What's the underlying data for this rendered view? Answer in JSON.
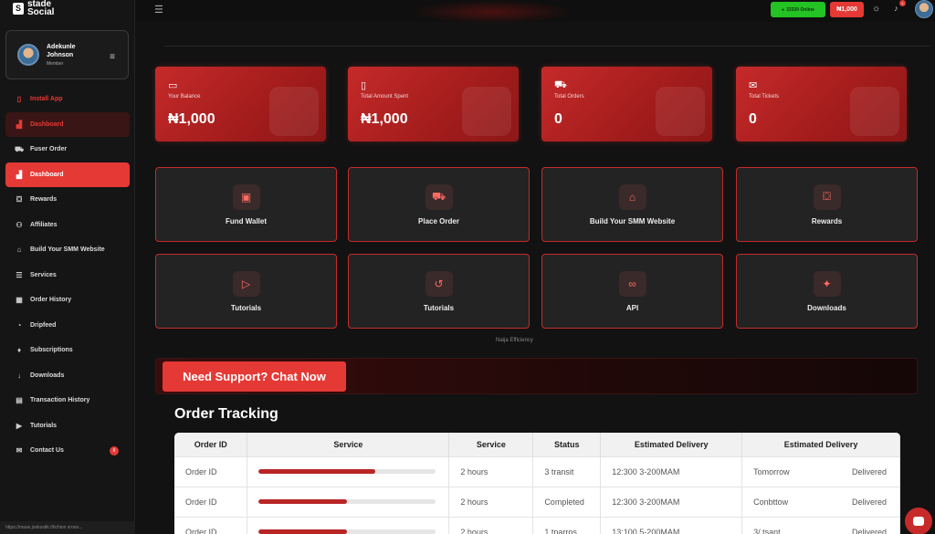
{
  "brand": {
    "line1": "stade",
    "line2": "Social"
  },
  "user": {
    "name": "Adekunle Johnson",
    "role": "Member"
  },
  "topbar": {
    "online_text": "33330 Online",
    "balance": "₦1,000",
    "notif_count": "1"
  },
  "nav": [
    {
      "label": "Install App",
      "icon": "download-app-icon",
      "glyph": "▯",
      "state": "red-text"
    },
    {
      "label": "Dashboard",
      "icon": "chart-icon",
      "glyph": "▟",
      "state": "dim-active"
    },
    {
      "label": "Fuser Order",
      "icon": "cart-icon",
      "glyph": "⛟",
      "state": ""
    },
    {
      "label": "Dashboard",
      "icon": "chart-icon",
      "glyph": "▟",
      "state": "active"
    },
    {
      "label": "Rewards",
      "icon": "gift-icon",
      "glyph": "⛋",
      "state": ""
    },
    {
      "label": "Affiliates",
      "icon": "users-icon",
      "glyph": "⚇",
      "state": ""
    },
    {
      "label": "Build Your SMM Website",
      "icon": "store-icon",
      "glyph": "⌂",
      "state": ""
    },
    {
      "label": "Services",
      "icon": "list-icon",
      "glyph": "☰",
      "state": ""
    },
    {
      "label": "Order History",
      "icon": "calendar-icon",
      "glyph": "▦",
      "state": ""
    },
    {
      "label": "Dripfeed",
      "icon": "clock-icon",
      "glyph": "◔",
      "state": ""
    },
    {
      "label": "Subscriptions",
      "icon": "thumbs-up-icon",
      "glyph": "♦",
      "state": ""
    },
    {
      "label": "Downloads",
      "icon": "arrow-down-icon",
      "glyph": "↓",
      "state": ""
    },
    {
      "label": "Transaction History",
      "icon": "receipt-icon",
      "glyph": "▤",
      "state": ""
    },
    {
      "label": "Tutorials",
      "icon": "play-icon",
      "glyph": "▶",
      "state": ""
    },
    {
      "label": "Contact Us",
      "icon": "chat-icon",
      "glyph": "✉",
      "state": "",
      "badge": "0"
    }
  ],
  "sidebar_footer": "https://mase.jooksstik://tichion vrooo...",
  "stats": [
    {
      "label": "Your Balance",
      "value": "₦1,000",
      "icon": "wallet-icon",
      "glyph": "▭"
    },
    {
      "label": "Total Amount Spent",
      "value": "₦1,000",
      "icon": "receipt-icon",
      "glyph": "▯"
    },
    {
      "label": "Total Orders",
      "value": "0",
      "icon": "cart-icon",
      "glyph": "⛟"
    },
    {
      "label": "Total Tickets",
      "value": "0",
      "icon": "chat-bubble-icon",
      "glyph": "✉"
    }
  ],
  "actions": [
    {
      "label": "Fund Wallet",
      "icon": "wallet-icon",
      "glyph": "▣"
    },
    {
      "label": "Place Order",
      "icon": "cart-icon",
      "glyph": "⛟"
    },
    {
      "label": "Build Your SMM Website",
      "icon": "store-icon",
      "glyph": "⌂"
    },
    {
      "label": "Rewards",
      "icon": "gift-icon",
      "glyph": "⛋"
    },
    {
      "label": "Tutorials",
      "icon": "play-icon",
      "glyph": "▷"
    },
    {
      "label": "Tutorials",
      "icon": "history-icon",
      "glyph": "↺"
    },
    {
      "label": "API",
      "icon": "link-icon",
      "glyph": "∞"
    },
    {
      "label": "Downloads",
      "icon": "stars-icon",
      "glyph": "✦"
    }
  ],
  "footer_note": "Naija Efficiency",
  "support": {
    "button": "Need Support? Chat Now"
  },
  "tracking": {
    "title": "Order Tracking",
    "headers": [
      "Order ID",
      "Service",
      "Service",
      "Status",
      "Estimated Delivery",
      "Estimated Delivery"
    ],
    "rows": [
      {
        "id": "Order ID",
        "progress": 0.66,
        "duration": "2 hours",
        "status": "3 transit",
        "window": "12:300 3-200MAM",
        "eta": "Tomorrow",
        "result": "Delivered"
      },
      {
        "id": "Order ID",
        "progress": 0.5,
        "duration": "2 hours",
        "status": "Completed",
        "window": "12:300 3-200MAM",
        "eta": "Conbttow",
        "result": "Delivered"
      },
      {
        "id": "Order ID",
        "progress": 0.5,
        "duration": "2 hours",
        "status": "1 tparros",
        "window": "13:100 5-200MAM",
        "eta": "3/ tsant",
        "result": "Delivered"
      }
    ]
  }
}
